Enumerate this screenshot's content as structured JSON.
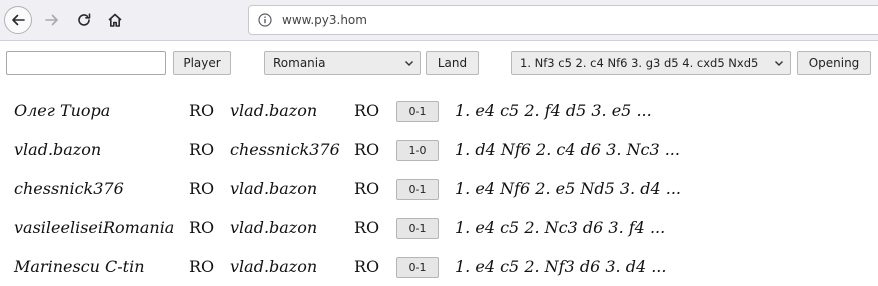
{
  "browser": {
    "url": "www.py3.hom"
  },
  "toolbar": {
    "player_input_value": "",
    "player_button": "Player",
    "country_selected": "Romania",
    "land_button": "Land",
    "opening_selected": "1. Nf3 c5 2. c4 Nf6 3. g3 d5 4. cxd5 Nxd5",
    "opening_button": "Opening"
  },
  "games": [
    {
      "white": "Олег Тиора",
      "white_country": "RO",
      "black": "vlad.bazon",
      "black_country": "RO",
      "result": "0-1",
      "moves": "1. e4 c5 2. f4 d5 3. e5 ..."
    },
    {
      "white": "vlad.bazon",
      "white_country": "RO",
      "black": "chessnick376",
      "black_country": "RO",
      "result": "1-0",
      "moves": "1. d4 Nf6 2. c4 d6 3. Nc3 ..."
    },
    {
      "white": "chessnick376",
      "white_country": "RO",
      "black": "vlad.bazon",
      "black_country": "RO",
      "result": "0-1",
      "moves": "1. e4 Nf6 2. e5 Nd5 3. d4 ..."
    },
    {
      "white": "vasileeliseiRomania",
      "white_country": "RO",
      "black": "vlad.bazon",
      "black_country": "RO",
      "result": "0-1",
      "moves": "1. e4 c5 2. Nc3 d6 3. f4 ..."
    },
    {
      "white": "Marinescu C-tin",
      "white_country": "RO",
      "black": "vlad.bazon",
      "black_country": "RO",
      "result": "0-1",
      "moves": "1. e4 c5 2. Nf3 d6 3. d4 ..."
    }
  ]
}
